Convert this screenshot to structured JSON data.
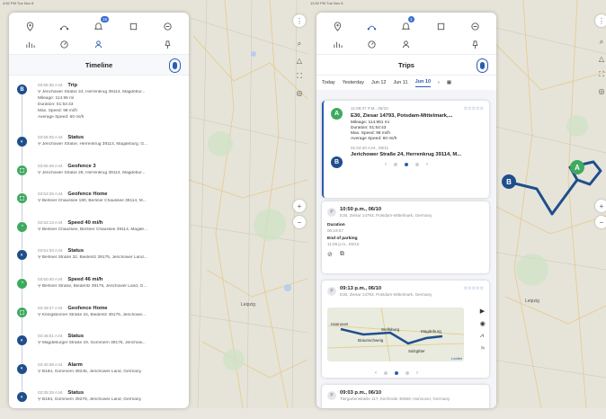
{
  "left_screen": {
    "status_bar": "4:52 PM Tue Nov 8",
    "nav_badge": "16",
    "panel_title": "Timeline",
    "events": [
      {
        "time": "03:56:35 A.M.",
        "type": "Trip",
        "letter": "B",
        "address": "Jerichower Straße 24, Herrenkrug 39114, Magdebur...",
        "details": [
          "Mileage: 114.96 mi",
          "Duration: 01:54:43",
          "Max. Speed: 98 mi/h",
          "Average Speed: 60 mi/h"
        ],
        "color": "navy"
      },
      {
        "time": "03:56:05 A.M.",
        "type": "Status",
        "letter": "◐",
        "address": "Jerichower Straße, Herrenkrug 39114, Magdeburg, G...",
        "details": [],
        "color": "navy"
      },
      {
        "time": "03:55:45 A.M.",
        "type": "Geofence 3",
        "letter": "⬚",
        "address": "Jerichower Straße 28, Herrenkrug 39114, Magdebur...",
        "details": [],
        "color": "green"
      },
      {
        "time": "03:53:25 A.M.",
        "type": "Geofence Home",
        "letter": "⬚",
        "address": "Berliner Chaussee 180, Berliner Chaussee 39114, M...",
        "details": [],
        "color": "green"
      },
      {
        "time": "03:52:13 A.M.",
        "type": "Speed 40 mi/h",
        "letter": "◔",
        "address": "Berliner Chaussee, Berliner Chaussee 39114, Magde...",
        "details": [],
        "color": "green"
      },
      {
        "time": "03:51:03 A.M.",
        "type": "Status",
        "letter": "◐",
        "address": "Berliner Straße 32, Biederitz 39175, Jerichower Land...",
        "details": [],
        "color": "navy"
      },
      {
        "time": "03:50:40 A.M.",
        "type": "Speed 46 mi/h",
        "letter": "◔",
        "address": "Berliner Straße, Biederitz 39175, Jerichower Land, G...",
        "details": [],
        "color": "green"
      },
      {
        "time": "03:49:27 A.M.",
        "type": "Geofence Home",
        "letter": "⬚",
        "address": "Königsborner Straße 24, Biederitz 39175, Jerichowe...",
        "details": [],
        "color": "green"
      },
      {
        "time": "03:46:01 A.M.",
        "type": "Status",
        "letter": "◐",
        "address": "Magdeburger Straße 19, Gommern 39175, Jerichow...",
        "details": [],
        "color": "navy"
      },
      {
        "time": "03:40:38 A.M.",
        "type": "Alarm",
        "letter": "◐",
        "address": "B184, Gommern 39245, Jerichower Land, Germany",
        "details": [],
        "color": "navy"
      },
      {
        "time": "03:35:28 A.M.",
        "type": "Status",
        "letter": "◐",
        "address": "B184, Gommern 39279, Jerichower Land, Germany",
        "details": [],
        "color": "navy"
      }
    ]
  },
  "right_screen": {
    "status_bar": "12:52 PM Tue Nov 8",
    "nav_badge": "1",
    "panel_title": "Trips",
    "tabs": [
      "Today",
      "Yesterday",
      "Jun 12",
      "Jun 11",
      "Jun 10"
    ],
    "active_tab": "Jun 10",
    "trip_card": {
      "start_time": "11:09:37 P.M., 06/10",
      "start_addr": "E30, Ziesar 14793, Potsdam-Mittelmark,...",
      "mileage": "Mileage: 114.961 mi",
      "duration": "Duration: 01:54:43",
      "max_speed": "Max. Speed: 98 mi/h",
      "avg_speed": "Average Speed: 60 mi/h",
      "end_time": "01:04:20 A.M., 06/11",
      "end_addr": "Jerichower Straße 24, Herrenkrug 39114, M...",
      "stars": "☆☆☆☆☆"
    },
    "parking_card": {
      "time": "10:50 p.m., 06/10",
      "addr": "E30, Ziesar 14793, Potsdam-Mittelmark, Germany",
      "duration_label": "Duration",
      "duration_value": "00:19:07",
      "end_label": "End of parking",
      "end_value": "11:09 p.m., 06/10"
    },
    "trip2_card": {
      "time": "09:13 p.m., 06/10",
      "addr": "E30, Ziesar 14793, Potsdam-Mittelmark, Germany",
      "stars": "☆☆☆☆☆",
      "map_labels": [
        "Hannover",
        "Wolfsburg",
        "Braunschweig",
        "Magdeburg",
        "Salzgitter",
        "Leaflet"
      ]
    },
    "trip3_card": {
      "time": "09:03 p.m., 06/10",
      "addr": "Tiergartenstraße 117, Kirchrode 30559, Hannover, Germany"
    }
  },
  "map_labels": [
    "Leipzig",
    "Leipzig",
    "Leipzig"
  ]
}
